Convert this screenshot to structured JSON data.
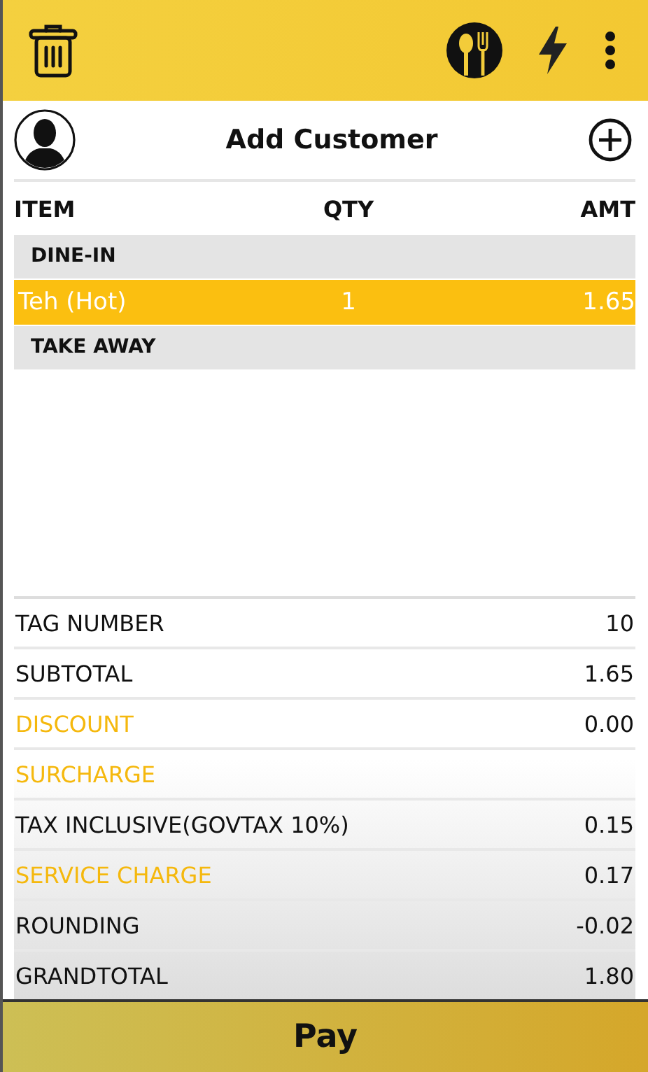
{
  "customer": {
    "title": "Add Customer"
  },
  "columns": [
    "ITEM",
    "QTY",
    "AMT"
  ],
  "sections": [
    {
      "label": "DINE-IN",
      "items": [
        {
          "name": "Teh (Hot)",
          "qty": "1",
          "amount": "1.65",
          "selected": true
        }
      ]
    },
    {
      "label": "TAKE AWAY"
    }
  ],
  "summary": [
    {
      "label": "TAG NUMBER",
      "value": "10",
      "kind": "info"
    },
    {
      "label": "SUBTOTAL",
      "value": "1.65",
      "kind": "info"
    },
    {
      "label": "DISCOUNT",
      "value": "0.00",
      "kind": "action"
    },
    {
      "label": "SURCHARGE",
      "kind": "action"
    },
    {
      "label": "TAX INCLUSIVE(GOVTAX 10%)",
      "value": "0.15",
      "kind": "info"
    },
    {
      "label": "SERVICE CHARGE",
      "value": "0.17",
      "kind": "action"
    },
    {
      "label": "ROUNDING",
      "value": "-0.02",
      "kind": "info"
    },
    {
      "label": "GRANDTOTAL",
      "value": "1.80",
      "kind": "info"
    }
  ],
  "pay_button": "Pay"
}
